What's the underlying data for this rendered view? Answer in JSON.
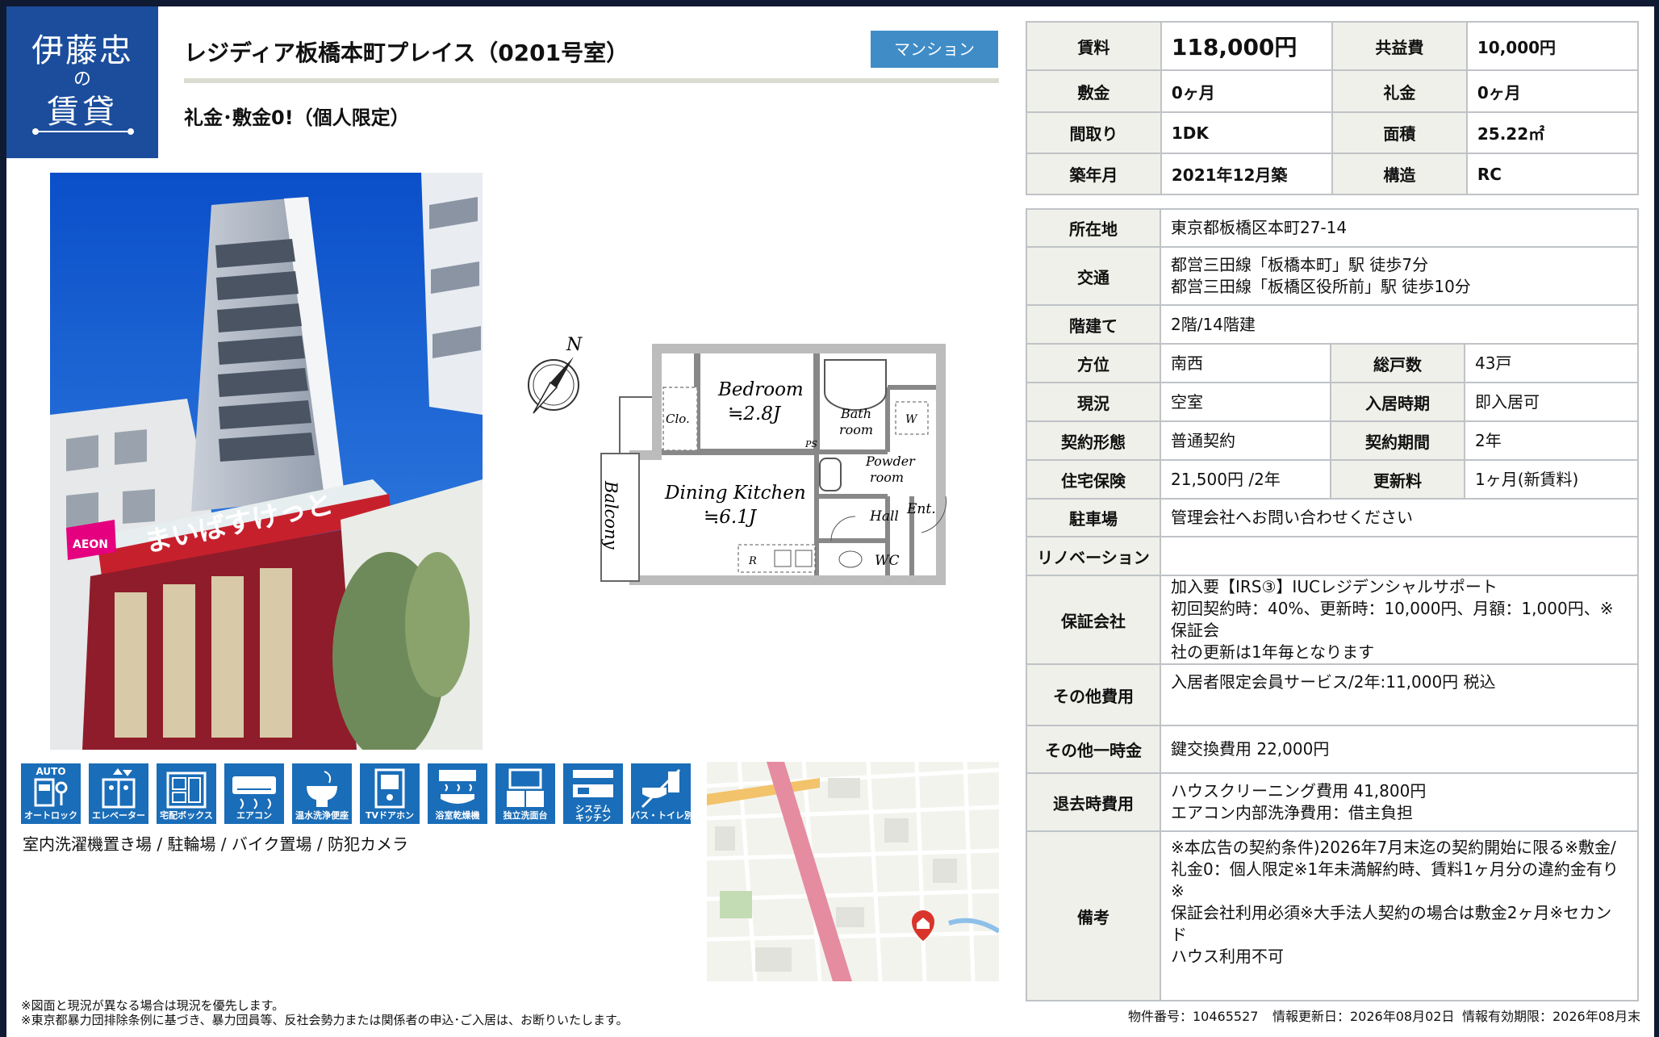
{
  "logo": {
    "line1": "伊藤忠",
    "line2": "の",
    "line3": "賃貸"
  },
  "header": {
    "title": "レジディア板橋本町プレイス（0201号室）",
    "type_badge": "マンション",
    "subtitle": "礼金･敷金0!（個人限定）"
  },
  "summary": {
    "rent_label": "賃料",
    "rent_value": "118,000円",
    "common_fee_label": "共益費",
    "common_fee_value": "10,000円",
    "deposit_label": "敷金",
    "deposit_value": "0ヶ月",
    "key_money_label": "礼金",
    "key_money_value": "0ヶ月",
    "layout_label": "間取り",
    "layout_value": "1DK",
    "area_label": "面積",
    "area_value": "25.22㎡",
    "built_label": "築年月",
    "built_value": "2021年12月築",
    "structure_label": "構造",
    "structure_value": "RC"
  },
  "details": {
    "address_label": "所在地",
    "address_value": "東京都板橋区本町27-14",
    "transport_label": "交通",
    "transport_line1": "都営三田線「板橋本町」駅 徒歩7分",
    "transport_line2": "都営三田線「板橋区役所前」駅 徒歩10分",
    "floors_label": "階建て",
    "floors_value": "2階/14階建",
    "direction_label": "方位",
    "direction_value": "南西",
    "units_label": "総戸数",
    "units_value": "43戸",
    "status_label": "現況",
    "status_value": "空室",
    "movein_label": "入居時期",
    "movein_value": "即入居可",
    "contract_label": "契約形態",
    "contract_value": "普通契約",
    "period_label": "契約期間",
    "period_value": "2年",
    "insurance_label": "住宅保険",
    "insurance_value": "21,500円 /2年",
    "renewal_label": "更新料",
    "renewal_value": "1ヶ月(新賃料)",
    "parking_label": "駐車場",
    "parking_value": "管理会社へお問い合わせください",
    "renovation_label": "リノベーション",
    "renovation_value": "",
    "guarantor_label": "保証会社",
    "guarantor_line1": "加入要【IRS③】IUCレジデンシャルサポート",
    "guarantor_line2": "初回契約時：40%、更新時：10,000円、月額：1,000円、※保証会",
    "guarantor_line3": "社の更新は1年毎となります",
    "other_cost_label": "その他費用",
    "other_cost_value": "入居者限定会員サービス/2年:11,000円 税込",
    "onetime_label": "その他一時金",
    "onetime_value": "鍵交換費用 22,000円",
    "moveout_label": "退去時費用",
    "moveout_line1": "ハウスクリーニング費用 41,800円",
    "moveout_line2": "エアコン内部洗浄費用：借主負担",
    "remarks_label": "備考",
    "remarks_line1": "※本広告の契約条件)2026年7月末迄の契約開始に限る※敷金/",
    "remarks_line2": "礼金0：個人限定※1年未満解約時、賃料1ヶ月分の違約金有り※",
    "remarks_line3": "保証会社利用必須※大手法人契約の場合は敷金2ヶ月※セカンド",
    "remarks_line4": "ハウス利用不可"
  },
  "floorplan": {
    "bedroom": "Bedroom",
    "bedroom_size": "≒2.8J",
    "dining": "Dining Kitchen",
    "dining_size": "≒6.1J",
    "closet": "Clo.",
    "bath1": "Bath",
    "bath2": "room",
    "powder1": "Powder",
    "powder2": "room",
    "hall": "Hall",
    "entrance": "Ent.",
    "wc": "WC",
    "balcony": "Balcony",
    "north": "N",
    "ps": "PS",
    "w": "W",
    "r": "R"
  },
  "icons": [
    {
      "top": "AUTO",
      "label": "オートロック",
      "name": "autolock-icon"
    },
    {
      "top": "",
      "label": "エレベーター",
      "name": "elevator-icon"
    },
    {
      "top": "",
      "label": "宅配ボックス",
      "name": "delivery-box-icon"
    },
    {
      "top": "",
      "label": "エアコン",
      "name": "air-conditioner-icon"
    },
    {
      "top": "",
      "label": "温水洗浄便座",
      "name": "washlet-icon"
    },
    {
      "top": "",
      "label": "TVドアホン",
      "name": "tv-intercom-icon"
    },
    {
      "top": "",
      "label": "浴室乾燥機",
      "name": "bathroom-dryer-icon"
    },
    {
      "top": "",
      "label": "独立洗面台",
      "name": "vanity-icon"
    },
    {
      "top": "",
      "label": "システム",
      "label2": "キッチン",
      "name": "system-kitchen-icon"
    },
    {
      "top": "",
      "label": "バス・トイレ別",
      "name": "separate-bath-icon"
    }
  ],
  "facilities": "室内洗濯機置き場 / 駐輪場 / バイク置場 / 防犯カメラ",
  "photo_sign": "まいばすけっと",
  "photo_logo": "AEON",
  "notes": {
    "line1": "※図面と現況が異なる場合は現況を優先します。",
    "line2": "※東京都暴力団排除条例に基づき、暴力団員等、反社会勢力または関係者の申込･ご入居は、お断りいたします。"
  },
  "footer": {
    "property_no": "物件番号：10465527",
    "updated": "情報更新日：2026年08月02日",
    "expires": "情報有効期限：2026年08月末"
  },
  "colors": {
    "brand_blue": "#1b4d9c",
    "badge_blue": "#3f8cc7",
    "icon_blue": "#1a6db8",
    "header_cell": "#f0f0ea"
  }
}
